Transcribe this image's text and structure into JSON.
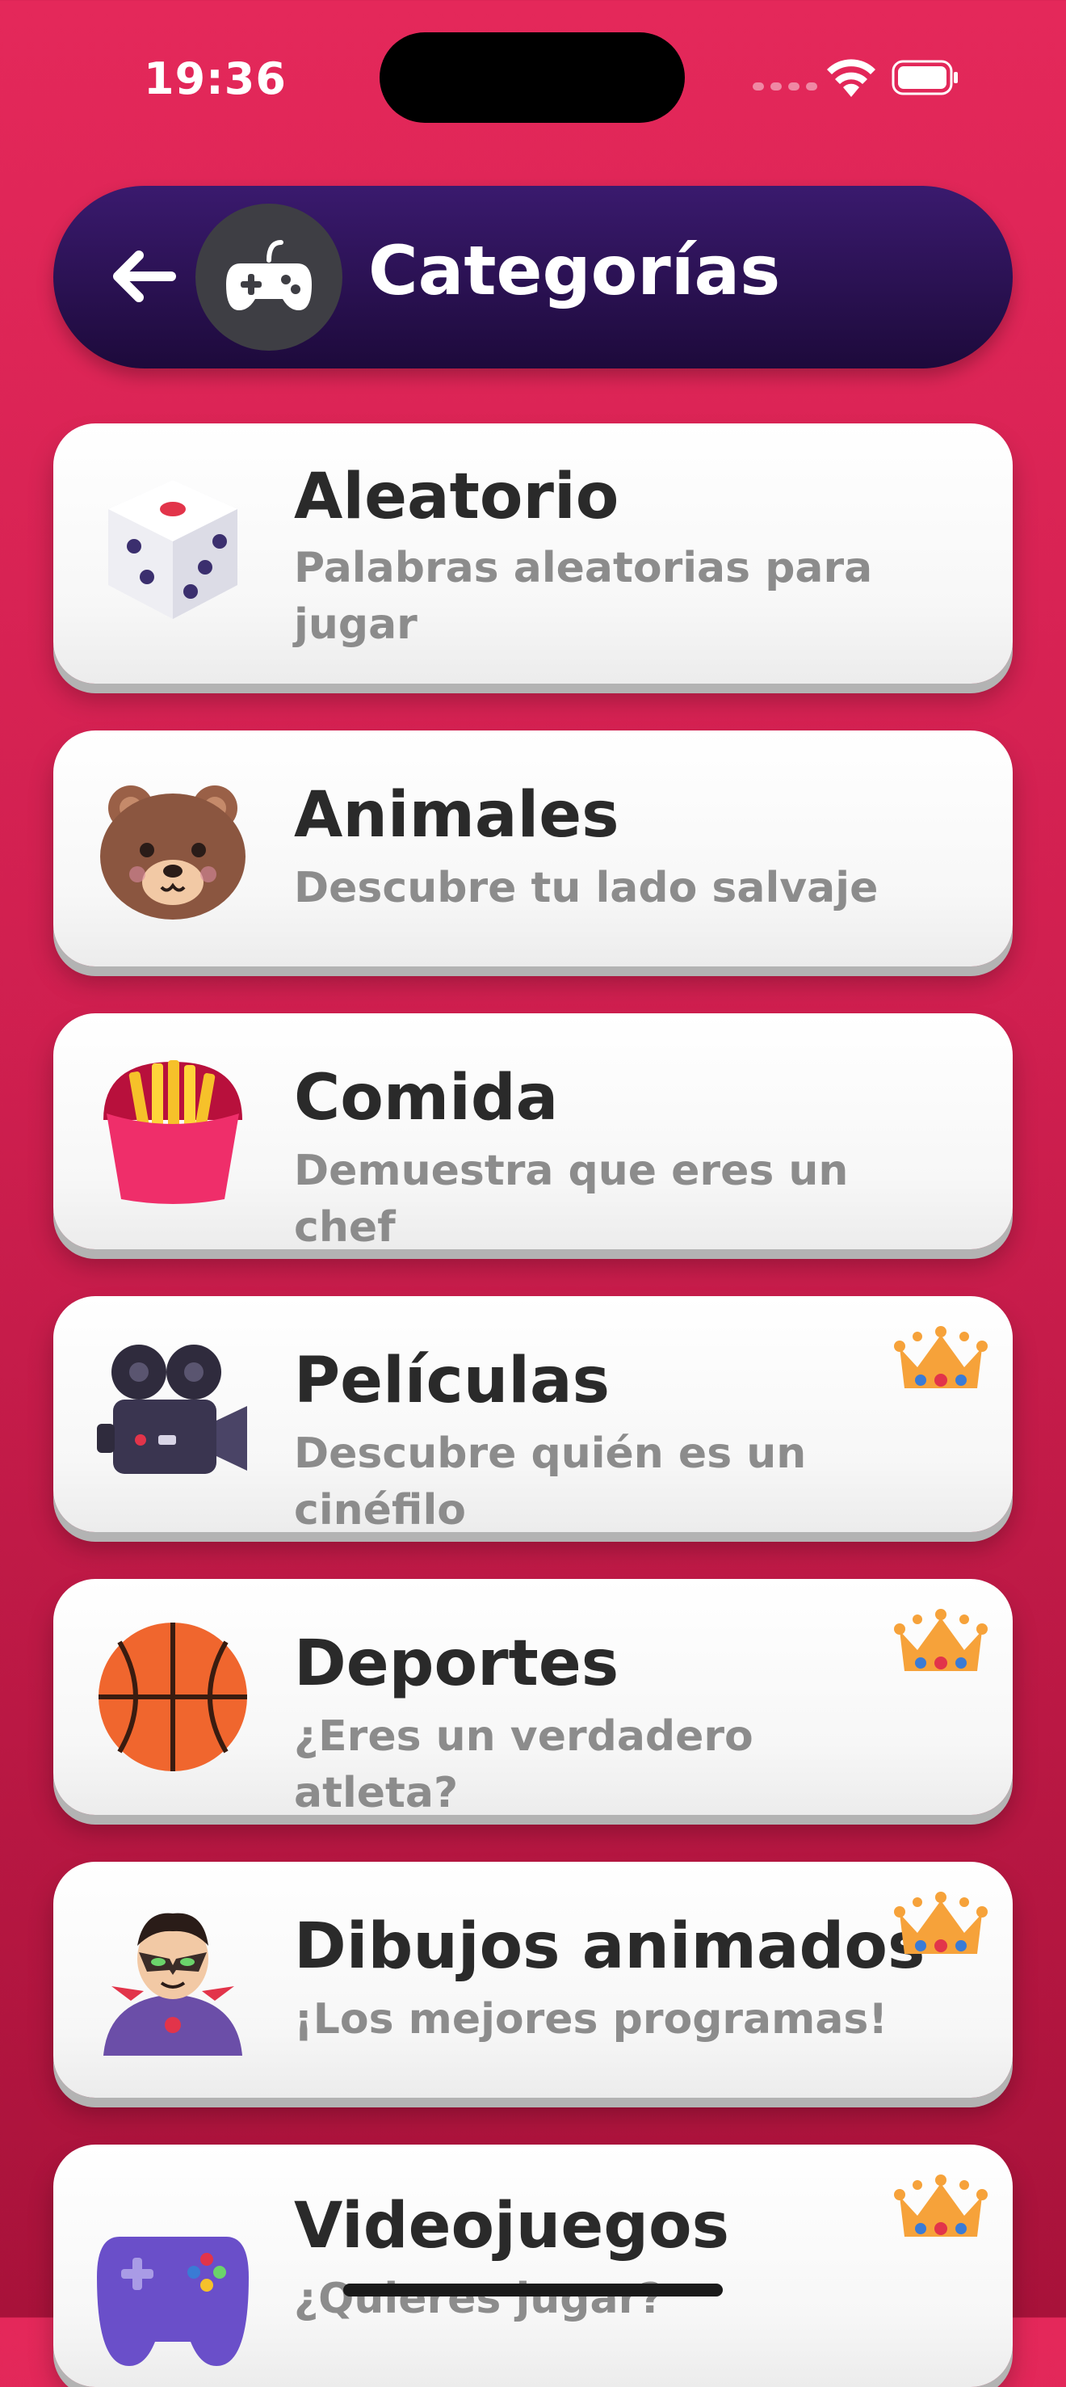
{
  "status": {
    "time": "19:36"
  },
  "header": {
    "title": "Categorías"
  },
  "categories": [
    {
      "title": "Aleatorio",
      "subtitle": "Palabras aleatorias para jugar",
      "icon": "dice-icon",
      "premium": false
    },
    {
      "title": "Animales",
      "subtitle": "Descubre tu lado salvaje",
      "icon": "bear-icon",
      "premium": false
    },
    {
      "title": "Comida",
      "subtitle": "Demuestra que eres un chef",
      "icon": "fries-icon",
      "premium": false
    },
    {
      "title": "Películas",
      "subtitle": "Descubre quién es un cinéfilo",
      "icon": "movie-camera-icon",
      "premium": true
    },
    {
      "title": "Deportes",
      "subtitle": "¿Eres un verdadero atleta?",
      "icon": "basketball-icon",
      "premium": true
    },
    {
      "title": "Dibujos animados",
      "subtitle": "¡Los mejores programas!",
      "icon": "villain-icon",
      "premium": true
    },
    {
      "title": "Videojuegos",
      "subtitle": "¿Quieres jugar?",
      "icon": "game-controller-icon",
      "premium": true
    }
  ],
  "colors": {
    "accent": "#e4285a",
    "header": "#2a1153",
    "crown": "#f6a23a"
  }
}
